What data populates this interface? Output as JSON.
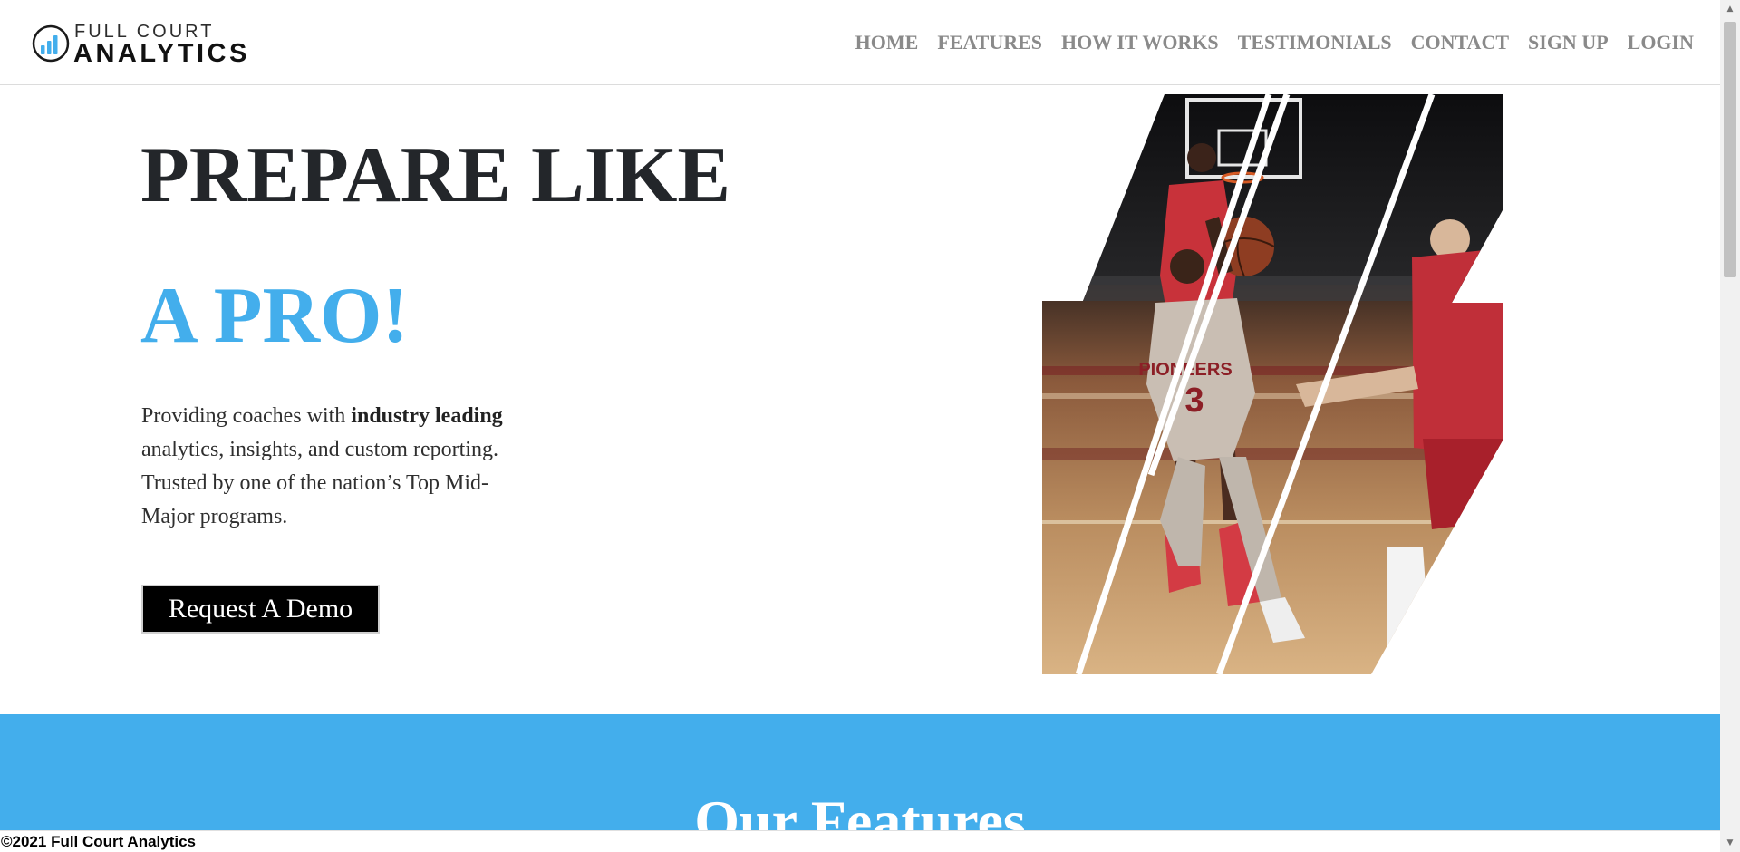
{
  "brand": {
    "name_top": "FULL COURT",
    "name_bottom": "ANALYTICS",
    "accent_color": "#43aeec"
  },
  "nav": {
    "items": [
      "HOME",
      "FEATURES",
      "HOW IT WORKS",
      "TESTIMONIALS",
      "CONTACT",
      "SIGN UP",
      "LOGIN"
    ]
  },
  "hero": {
    "line1": "PREPARE LIKE",
    "line2": "A PRO!",
    "desc_prefix": "Providing coaches with ",
    "desc_bold": "industry leading",
    "desc_suffix": " analytics, insights, and custom reporting. Trusted by one of the nation’s Top Mid-Major programs.",
    "button": "Request A Demo",
    "image_icon": "basketball-action-photo",
    "jersey_text": "PIONEERS",
    "jersey_number": "3"
  },
  "features": {
    "title": "Our Features"
  },
  "footer": {
    "text": "©2021 Full Court Analytics"
  }
}
